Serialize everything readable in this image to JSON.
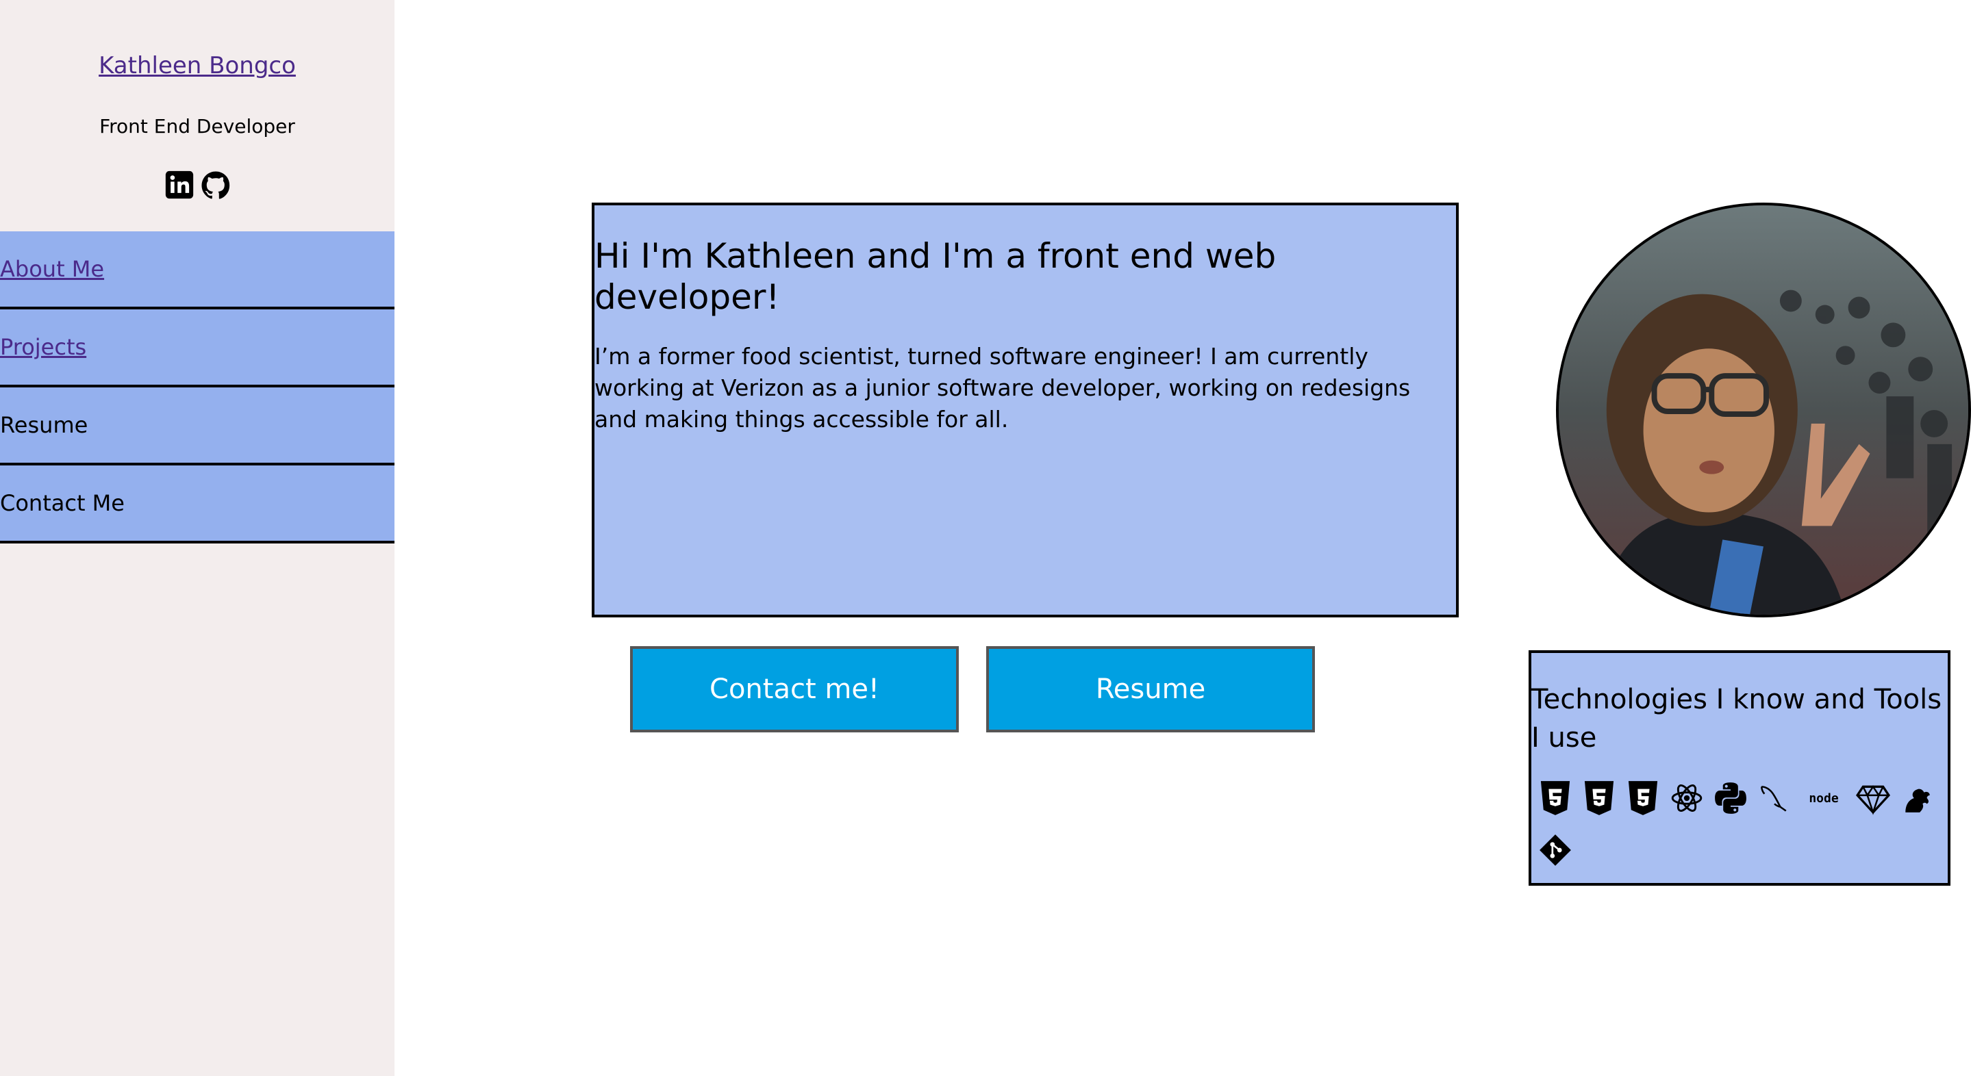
{
  "sidebar": {
    "name": "Kathleen Bongco",
    "role": "Front End Developer",
    "social_icons": [
      "linkedin-icon",
      "github-icon"
    ],
    "nav": [
      {
        "label": "About Me",
        "link": true
      },
      {
        "label": "Projects",
        "link": true
      },
      {
        "label": "Resume",
        "link": false
      },
      {
        "label": "Contact Me",
        "link": false
      }
    ]
  },
  "intro": {
    "title": "Hi I'm Kathleen and I'm a front end web developer!",
    "text": "I’m a former food scientist, turned software engineer! I am currently working at Verizon as a junior software developer, working on redesigns and making things accessible for all."
  },
  "buttons": {
    "contact": "Contact me!",
    "resume": "Resume"
  },
  "tech": {
    "title": "Technologies I know and Tools I use",
    "icons": [
      "html5-icon",
      "css3-icon",
      "javascript-icon",
      "react-icon",
      "python-icon",
      "mysql-icon",
      "nodejs-icon",
      "sketch-icon",
      "sass-icon",
      "git-icon"
    ],
    "node_label": "node"
  },
  "colors": {
    "sidebar_bg": "#f3eded",
    "nav_bg": "#94b0ee",
    "card_bg": "#a9bff2",
    "button_bg": "#00a0e2",
    "link": "#4b2a8a"
  }
}
